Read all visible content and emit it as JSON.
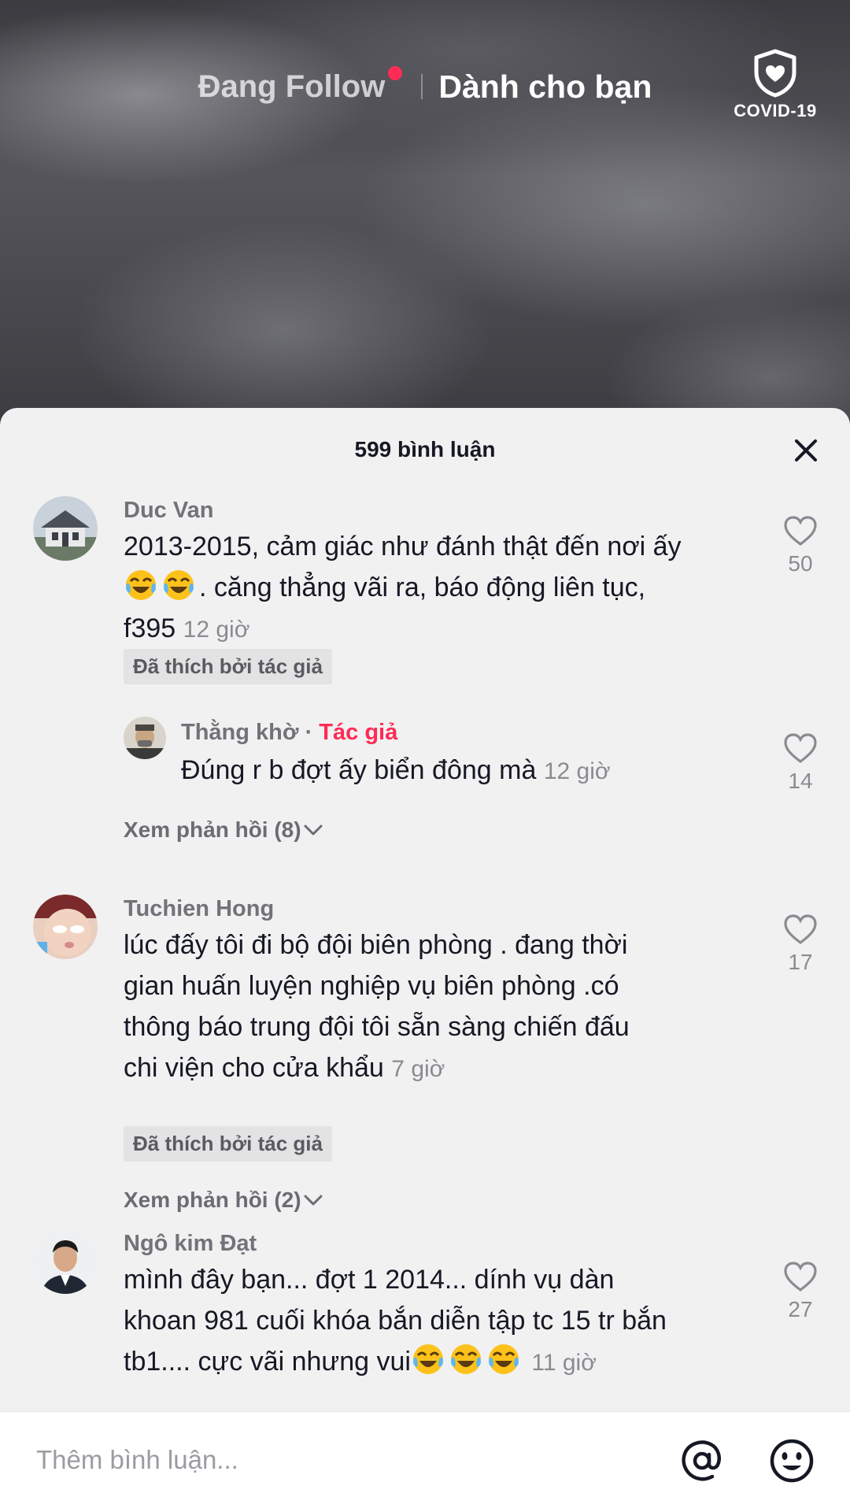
{
  "top_nav": {
    "following_label": "Đang Follow",
    "for_you_label": "Dành cho bạn",
    "covid_label": "COVID-19",
    "live_dot_color": "#fe2c55"
  },
  "sheet": {
    "title": "599 bình luận"
  },
  "comments": [
    {
      "username": "Duc Van",
      "line1": "2013-2015, cảm giác như đánh thật đến nơi ấy",
      "line2_suffix": ". căng thẳng vãi ra, báo động liên tục,",
      "line3": "f395",
      "timestamp": "12 giờ",
      "liked_by_author": "Đã thích bởi tác giả",
      "likes": "50",
      "reply": {
        "username": "Thằng khờ",
        "separator": " · ",
        "author_tag": "Tác giả",
        "text": "Đúng r b đợt ấy biển đông mà",
        "timestamp": "12 giờ",
        "likes": "14"
      },
      "view_replies": "Xem phản hồi (8)"
    },
    {
      "username": "Tuchien Hong",
      "lines": [
        "lúc đấy tôi đi bộ đội biên phòng . đang thời",
        "gian huấn luyện nghiệp vụ biên phòng .có",
        "thông báo trung đội tôi sẵn sàng chiến đấu",
        "chi viện cho cửa khẩu"
      ],
      "timestamp": "7 giờ",
      "liked_by_author": "Đã thích bởi tác giả",
      "likes": "17",
      "view_replies": "Xem phản hồi (2)"
    },
    {
      "username": "Ngô kim Đạt",
      "lines": [
        "mình đây bạn... đợt 1 2014... dính vụ dàn",
        "khoan 981 cuối khóa bắn diễn tập tc 15 tr bắn",
        "tb1.... cực vãi nhưng vui"
      ],
      "timestamp": "11 giờ",
      "likes": "27"
    }
  ],
  "input": {
    "placeholder": "Thêm bình luận..."
  },
  "icons": {
    "covid": "shield-heart-icon",
    "close": "close-icon",
    "like": "heart-outline-icon",
    "chevron": "chevron-down-icon",
    "mention": "at-icon",
    "emoji": "smiley-icon",
    "laugh_emoji": "tears-of-joy-emoji"
  }
}
